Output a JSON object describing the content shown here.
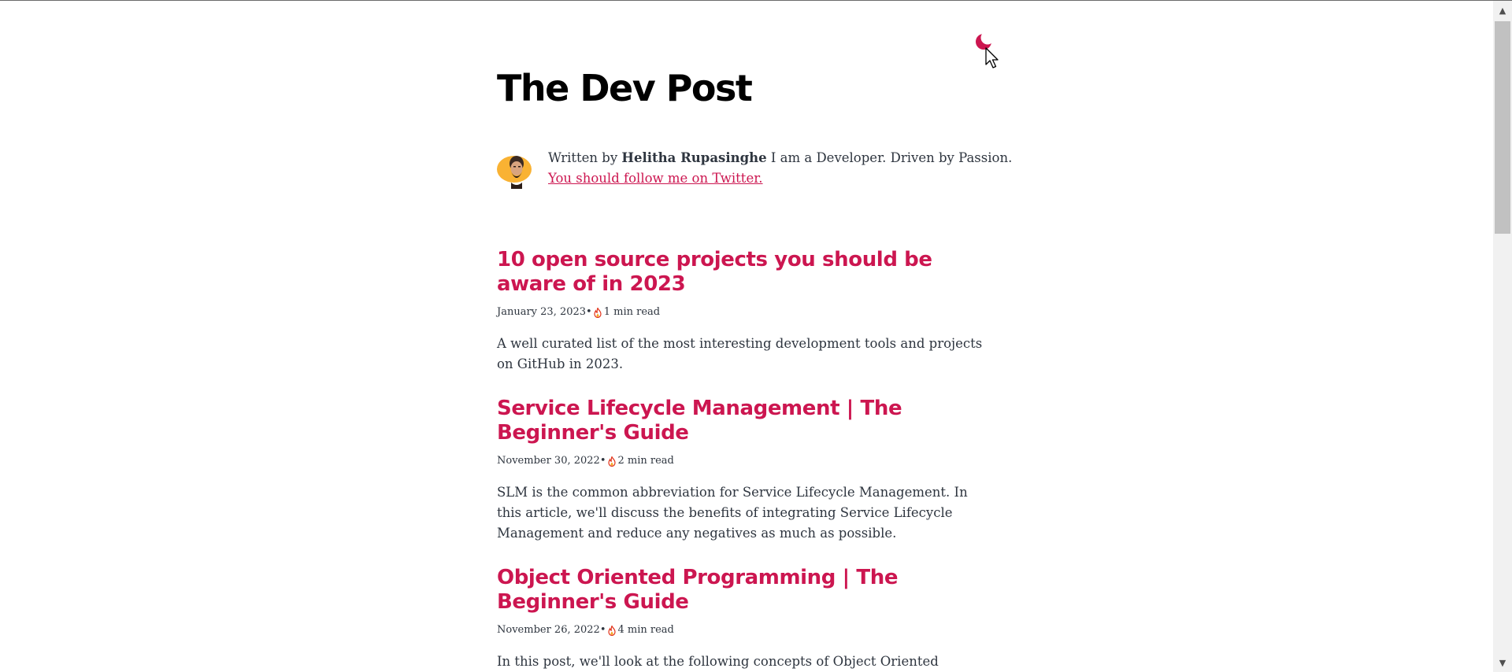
{
  "site": {
    "title": "The Dev Post",
    "accent_color": "#cc1650",
    "theme_toggle_icon": "moon-icon"
  },
  "bio": {
    "prefix": "Written by",
    "author": "Helitha Rupasinghe",
    "tagline": "I am a Developer. Driven by Passion.",
    "twitter_link_text": "You should follow me on Twitter."
  },
  "posts": [
    {
      "title": "10 open source projects you should be aware of in 2023",
      "date": "January 23, 2023",
      "separator": "•",
      "read_time": "1 min read",
      "excerpt": "A well curated list of the most interesting development tools and projects on GitHub in 2023."
    },
    {
      "title": "Service Lifecycle Management | The Beginner's Guide",
      "date": "November 30, 2022",
      "separator": "•",
      "read_time": "2 min read",
      "excerpt": "SLM is the common abbreviation for Service Lifecycle Management. In this article, we'll discuss the benefits of integrating Service Lifecycle Management and reduce any negatives as much as possible."
    },
    {
      "title": "Object Oriented Programming | The Beginner's Guide",
      "date": "November 26, 2022",
      "separator": "•",
      "read_time": "4 min read",
      "excerpt": "In this post, we'll look at the following concepts of Object Oriented"
    }
  ]
}
